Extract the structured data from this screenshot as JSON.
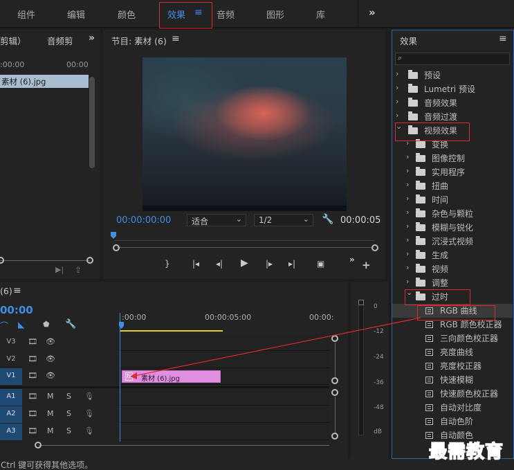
{
  "workspace": {
    "tabs": [
      "组件",
      "编辑",
      "颜色",
      "效果",
      "音频",
      "图形",
      "库"
    ],
    "active": "效果",
    "menu_glyph": "≡",
    "more_glyph": "»"
  },
  "source": {
    "title_left": "剪辑）",
    "title_audio": "音频剪",
    "ruler_left": ":00:00",
    "ruler_right": "00:00",
    "clip_name": "素材 (6).jpg"
  },
  "program": {
    "title": "节目: 素材 (6)",
    "menu_glyph": "≡",
    "timecode_current": "00:00:00:00",
    "fit_label": "适合",
    "resolution_label": "1/2",
    "timecode_duration": "00:00:05"
  },
  "timeline": {
    "title": "(6)",
    "menu_glyph": "≡",
    "timecode": "00:00",
    "ruler": [
      ":00:00",
      "00:00:05:00",
      "00:00:"
    ],
    "video_tracks": [
      "V3",
      "V2",
      "V1"
    ],
    "audio_tracks": [
      "A1",
      "A2",
      "A3"
    ],
    "mute_label": "M",
    "solo_label": "S",
    "clip_name": "素材 (6).jpg",
    "clip_fx_badge": "fx"
  },
  "meter": {
    "scale": [
      "0",
      "-12",
      "-24",
      "-36",
      "-48",
      "dB"
    ]
  },
  "effects": {
    "title": "效果",
    "menu_glyph": "≡",
    "items": [
      {
        "label": "预设",
        "level": 0,
        "type": "folder-star",
        "expanded": false
      },
      {
        "label": "Lumetri 预设",
        "level": 0,
        "type": "folder-star",
        "expanded": false
      },
      {
        "label": "音频效果",
        "level": 0,
        "type": "folder",
        "expanded": false
      },
      {
        "label": "音频过渡",
        "level": 0,
        "type": "folder",
        "expanded": false
      },
      {
        "label": "视频效果",
        "level": 0,
        "type": "folder",
        "expanded": true
      },
      {
        "label": "变换",
        "level": 1,
        "type": "folder",
        "expanded": false
      },
      {
        "label": "图像控制",
        "level": 1,
        "type": "folder",
        "expanded": false
      },
      {
        "label": "实用程序",
        "level": 1,
        "type": "folder",
        "expanded": false
      },
      {
        "label": "扭曲",
        "level": 1,
        "type": "folder",
        "expanded": false
      },
      {
        "label": "时间",
        "level": 1,
        "type": "folder",
        "expanded": false
      },
      {
        "label": "杂色与颗粒",
        "level": 1,
        "type": "folder",
        "expanded": false
      },
      {
        "label": "模糊与锐化",
        "level": 1,
        "type": "folder",
        "expanded": false
      },
      {
        "label": "沉浸式视频",
        "level": 1,
        "type": "folder",
        "expanded": false
      },
      {
        "label": "生成",
        "level": 1,
        "type": "folder",
        "expanded": false
      },
      {
        "label": "视频",
        "level": 1,
        "type": "folder",
        "expanded": false
      },
      {
        "label": "调整",
        "level": 1,
        "type": "folder",
        "expanded": false
      },
      {
        "label": "过时",
        "level": 1,
        "type": "folder",
        "expanded": true
      },
      {
        "label": "RGB 曲线",
        "level": 2,
        "type": "preset",
        "selected": true
      },
      {
        "label": "RGB 颜色校正器",
        "level": 2,
        "type": "preset"
      },
      {
        "label": "三向颜色校正器",
        "level": 2,
        "type": "preset"
      },
      {
        "label": "亮度曲线",
        "level": 2,
        "type": "preset"
      },
      {
        "label": "亮度校正器",
        "level": 2,
        "type": "preset"
      },
      {
        "label": "快速模糊",
        "level": 2,
        "type": "preset"
      },
      {
        "label": "快速颜色校正器",
        "level": 2,
        "type": "preset"
      },
      {
        "label": "自动对比度",
        "level": 2,
        "type": "preset"
      },
      {
        "label": "自动色阶",
        "level": 2,
        "type": "preset"
      },
      {
        "label": "自动颜色",
        "level": 2,
        "type": "preset"
      }
    ]
  },
  "status": {
    "text": "Ctrl 键可获得其他选项。"
  },
  "watermark": "最需教育",
  "colors": {
    "accent": "#3d8ee6",
    "highlight_box": "#e0282e",
    "clip": "#e08ee0",
    "arrow": "#e0282e"
  }
}
